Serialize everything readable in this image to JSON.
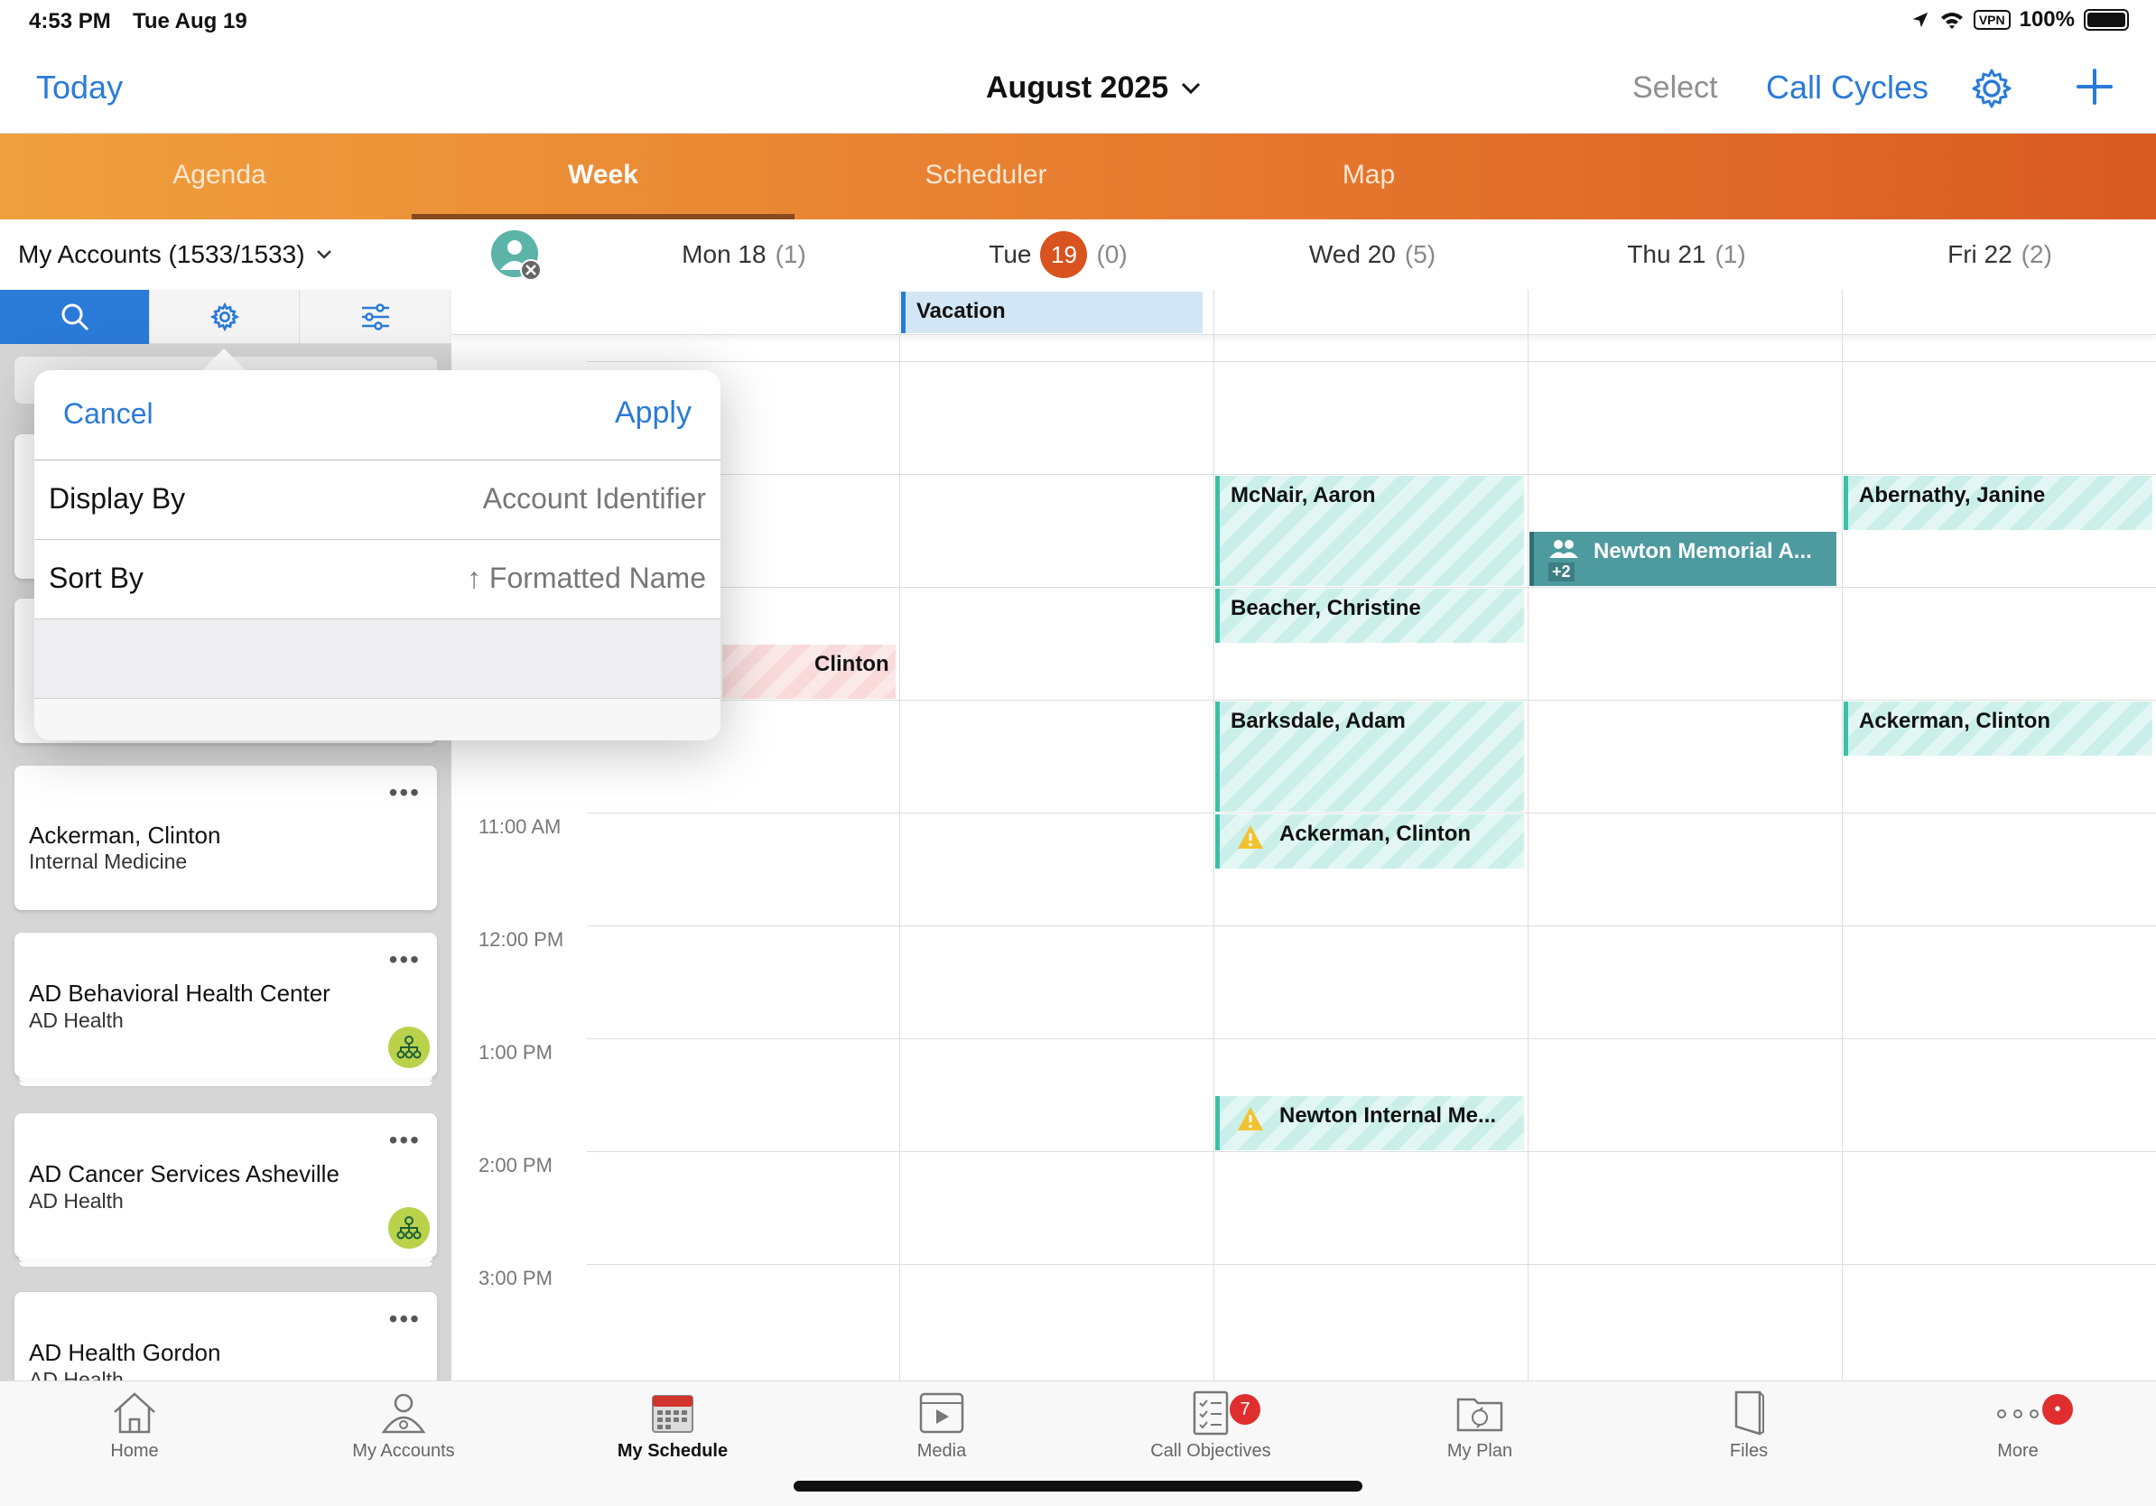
{
  "status_bar": {
    "time": "4:53 PM",
    "date": "Tue Aug 19",
    "vpn": "VPN",
    "battery": "100%"
  },
  "header": {
    "today": "Today",
    "month": "August 2025",
    "select": "Select",
    "call_cycles": "Call Cycles",
    "accent": "#2a7ad8"
  },
  "view_tabs": [
    "Agenda",
    "Week",
    "Scheduler",
    "Map"
  ],
  "active_view": "Week",
  "accounts": {
    "header": "My Accounts (1533/1533)",
    "cards": [
      {
        "name": "Ackerman, Clinton",
        "sub": "Internal Medicine"
      },
      {
        "name": "AD Behavioral Health Center",
        "sub": "AD Health"
      },
      {
        "name": "AD Cancer Services Asheville",
        "sub": "AD Health"
      },
      {
        "name": "AD Health Gordon",
        "sub": "AD Health"
      }
    ]
  },
  "popover": {
    "cancel": "Cancel",
    "apply": "Apply",
    "display_by_label": "Display By",
    "display_by_value": "Account Identifier",
    "sort_by_label": "Sort By",
    "sort_by_value": "↑ Formatted Name"
  },
  "calendar": {
    "days": [
      {
        "label": "Mon 18",
        "count": "(1)"
      },
      {
        "label": "Tue",
        "badge": "19",
        "count": "(0)"
      },
      {
        "label": "Wed 20",
        "count": "(5)"
      },
      {
        "label": "Thu 21",
        "count": "(1)"
      },
      {
        "label": "Fri 22",
        "count": "(2)"
      }
    ],
    "all_day": {
      "vacation": "Vacation"
    },
    "time_labels": [
      "11:00 AM",
      "12:00 PM",
      "1:00 PM",
      "2:00 PM",
      "3:00 PM"
    ],
    "events": {
      "mon_clinton": "Clinton",
      "wed_mcnair": "McNair, Aaron",
      "wed_beacher": "Beacher, Christine",
      "wed_barksdale": "Barksdale, Adam",
      "wed_ackerman": "Ackerman, Clinton",
      "wed_newton": "Newton Internal Me...",
      "thu_newton": "Newton Memorial A...",
      "thu_newton_more": "+2",
      "fri_abernathy": "Abernathy, Janine",
      "fri_ackerman": "Ackerman, Clinton"
    }
  },
  "bottom_tabs": [
    {
      "label": "Home",
      "icon": "home-icon"
    },
    {
      "label": "My Accounts",
      "icon": "accounts-icon"
    },
    {
      "label": "My Schedule",
      "icon": "calendar-icon"
    },
    {
      "label": "Media",
      "icon": "media-icon"
    },
    {
      "label": "Call Objectives",
      "icon": "objectives-icon",
      "badge": "7"
    },
    {
      "label": "My Plan",
      "icon": "plan-icon"
    },
    {
      "label": "Files",
      "icon": "files-icon"
    },
    {
      "label": "More",
      "icon": "more-icon",
      "badge": "•"
    }
  ]
}
